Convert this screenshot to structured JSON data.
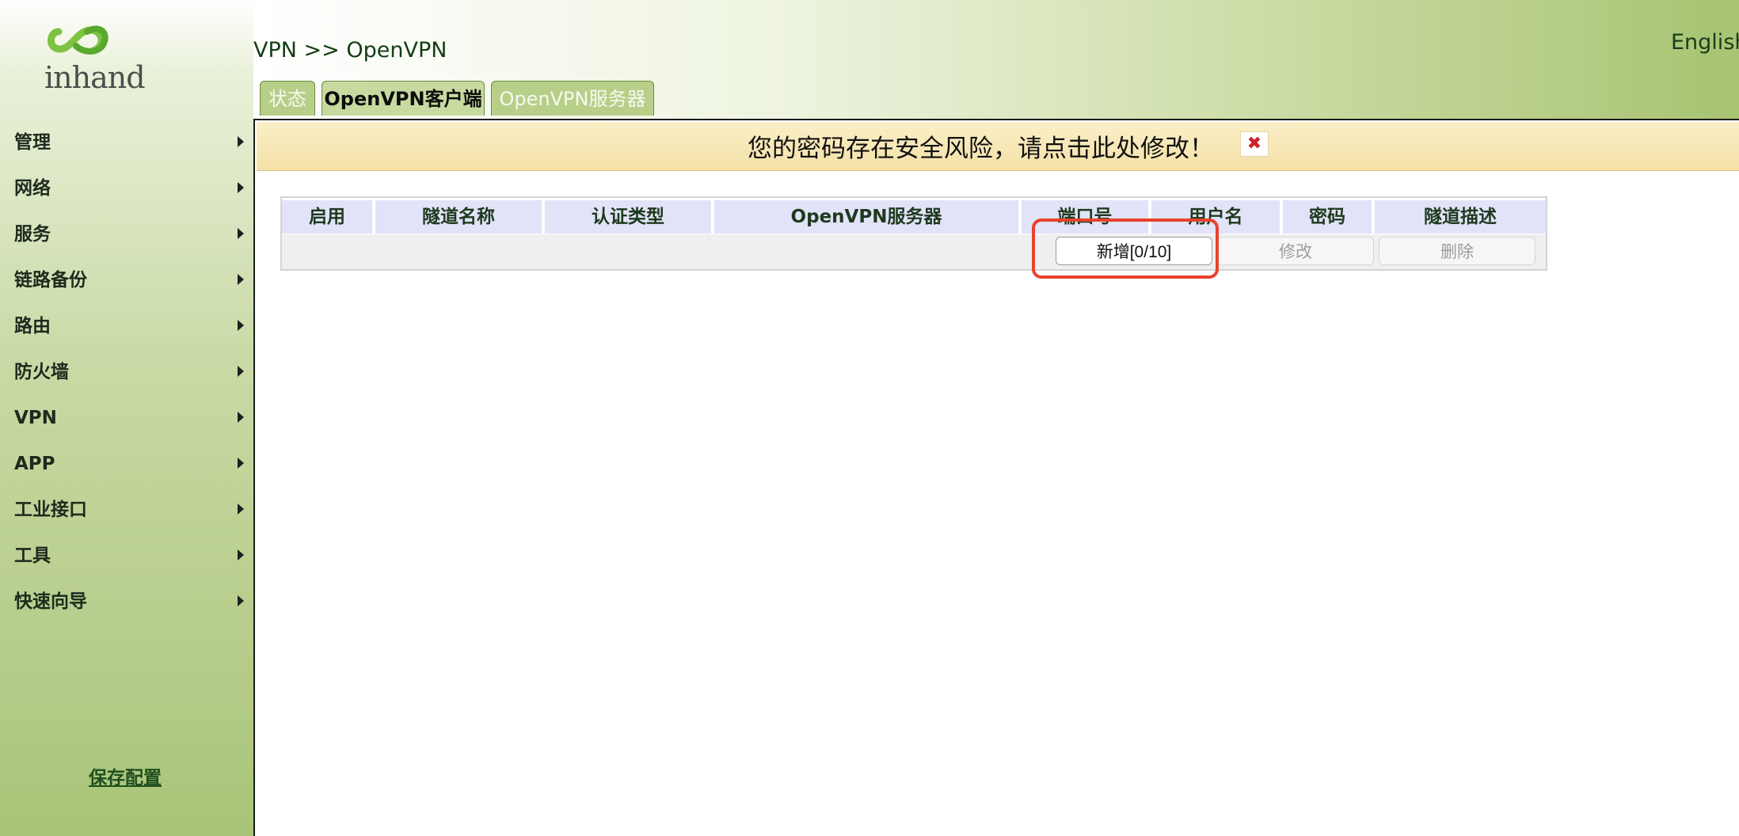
{
  "sidebar": {
    "logo_text": "inhand",
    "menu": [
      {
        "label": "管理"
      },
      {
        "label": "网络"
      },
      {
        "label": "服务"
      },
      {
        "label": "链路备份"
      },
      {
        "label": "路由"
      },
      {
        "label": "防火墙"
      },
      {
        "label": "VPN"
      },
      {
        "label": "APP"
      },
      {
        "label": "工业接口"
      },
      {
        "label": "工具"
      },
      {
        "label": "快速向导"
      }
    ],
    "save_config": "保存配置"
  },
  "header": {
    "breadcrumb": "VPN >> OpenVPN",
    "language": "English",
    "tabs": [
      {
        "label": "状态",
        "active": false
      },
      {
        "label": "OpenVPN客户端",
        "active": true
      },
      {
        "label": "OpenVPN服务器",
        "active": false
      }
    ]
  },
  "warning": {
    "text": "您的密码存在安全风险，请点击此处修改！",
    "close_symbol": "✖",
    "close_color": "#d0212a"
  },
  "table": {
    "columns": [
      "启用",
      "隧道名称",
      "认证类型",
      "OpenVPN服务器",
      "端口号",
      "用户名",
      "密码",
      "隧道描述"
    ],
    "rows": [],
    "buttons": {
      "add": "新增[0/10]",
      "edit": "修改",
      "delete": "删除"
    }
  },
  "colors": {
    "header_accent": "#a8c372",
    "table_header_bg": "#e2e2f8",
    "highlight": "#e8422e"
  }
}
